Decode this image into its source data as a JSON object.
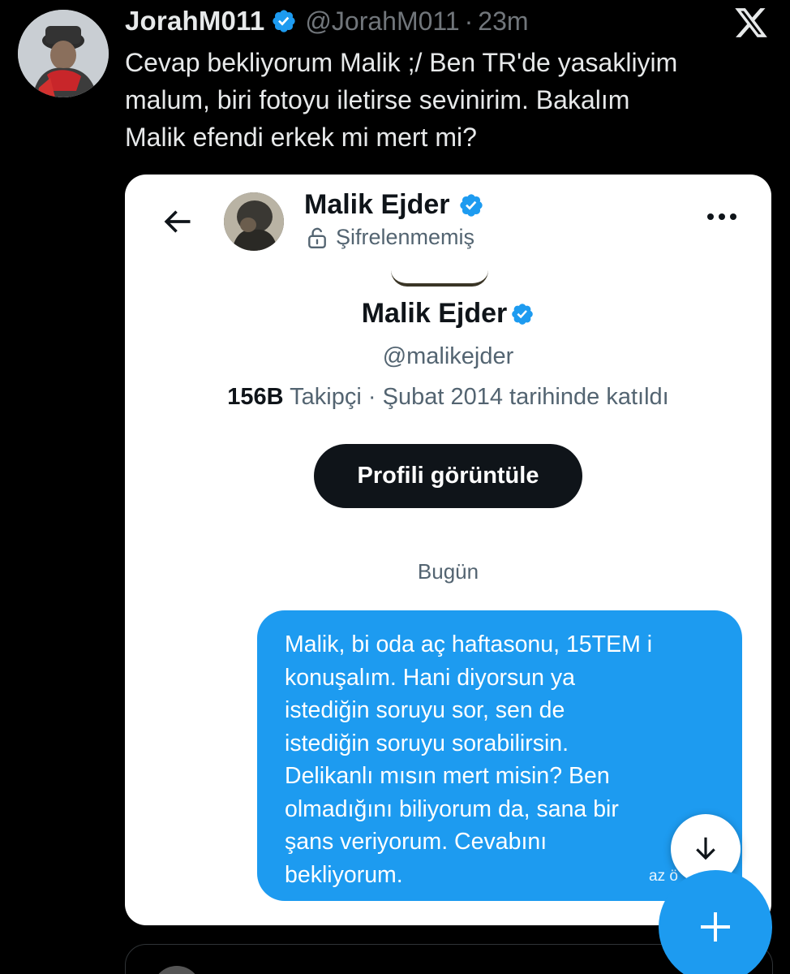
{
  "tweet": {
    "display_name": "JorahM011",
    "handle": "@JorahM011",
    "separator": "·",
    "time": "23m",
    "text_lines": [
      "Cevap bekliyorum Malik ;/ Ben TR'de yasakliyim",
      "malum, biri fotoyu iletirse sevinirim. Bakalım",
      "Malik efendi erkek mi mert mi?"
    ],
    "verified_color": "#1d9bf0",
    "logo_icon": "x-logo-icon"
  },
  "card": {
    "header": {
      "name": "Malik Ejder",
      "encryption_status": "Şifrelenmemiş",
      "back_icon": "arrow-left-icon",
      "more_icon": "more-horizontal-icon",
      "lock_icon": "unlocked-icon"
    },
    "profile": {
      "name": "Malik Ejder",
      "handle": "@malikejder",
      "followers_count": "156B",
      "followers_label": "Takipçi",
      "meta_separator": "·",
      "joined": "Şubat 2014 tarihinde katıldı",
      "view_profile_label": "Profili görüntüle"
    },
    "date_separator": "Bugün",
    "message": {
      "lines": [
        "Malik, bi oda aç haftasonu, 15TEM i",
        "konuşalım. Hani diyorsun ya",
        "istediğin soruyu sor, sen de",
        "istediğin soruyu sorabilirsin.",
        "Delikanlı mısın mert misin? Ben",
        "olmadığını biliyorum da, sana bir",
        "şans veriyorum. Cevabını",
        "bekliyorum."
      ],
      "time_partial": "az ö",
      "bubble_color": "#1d9bf0"
    },
    "scroll_icon": "arrow-down-icon"
  },
  "fab": {
    "icon": "plus-icon",
    "color": "#1d9bf0"
  }
}
